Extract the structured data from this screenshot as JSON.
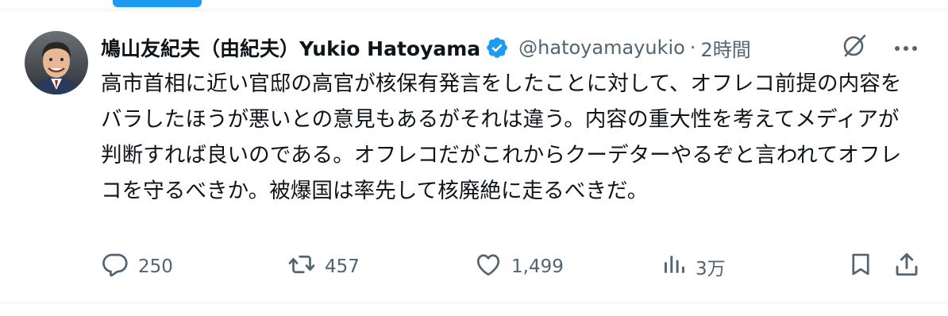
{
  "author": {
    "display_name": "鳩山友紀夫（由紀夫）Yukio Hatoyama",
    "handle": "@hatoyamayukio",
    "separator": "·",
    "timestamp": "2時間",
    "verified": true
  },
  "tweet": {
    "text": "高市首相に近い官邸の高官が核保有発言をしたことに対して、オフレコ前提の内容をバラしたほうが悪いとの意見もあるがそれは違う。内容の重大性を考えてメディアが判断すれば良いのである。オフレコだがこれからクーデターやるぞと言われてオフレコを守るべきか。被爆国は率先して核廃絶に走るべきだ。"
  },
  "metrics": {
    "replies": "250",
    "retweets": "457",
    "likes": "1,499",
    "views": "3万"
  },
  "icons": {
    "verified": "verified-badge-icon",
    "grok": "grok-icon",
    "more": "more-icon",
    "reply": "reply-icon",
    "retweet": "retweet-icon",
    "like": "heart-icon",
    "views": "views-icon",
    "bookmark": "bookmark-icon",
    "share": "share-icon"
  },
  "colors": {
    "accent": "#1d9bf0",
    "text": "#0f1419",
    "secondary": "#536471",
    "divider": "#eff3f4"
  }
}
